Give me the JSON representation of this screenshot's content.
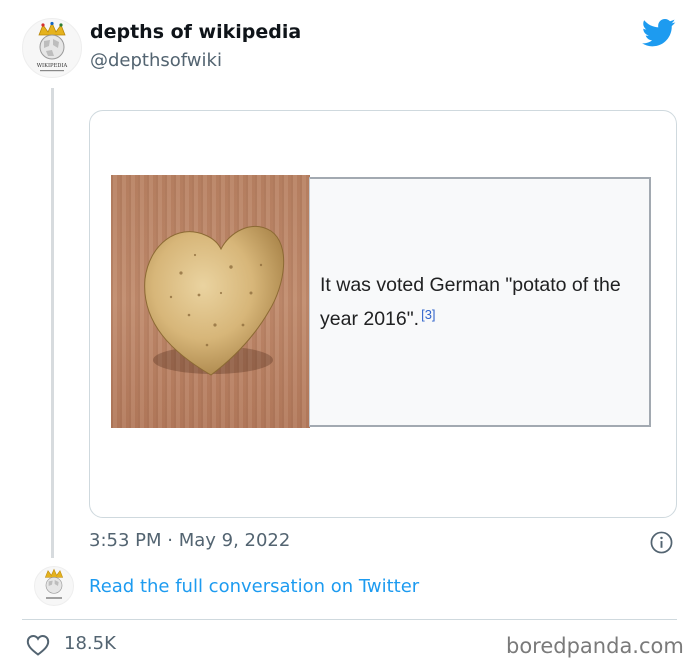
{
  "tweet": {
    "author_name": "depths of wikipedia",
    "author_handle": "@depthsofwiki",
    "avatar_label": "WIKIPEDIA",
    "timestamp": "3:53 PM · May 9, 2022",
    "read_more": "Read the full conversation on Twitter",
    "likes": "18.5K"
  },
  "card": {
    "image_icon": "heart-shaped-potato-image",
    "caption": "It was voted German \"potato of the year 2016\".",
    "citation": "[3]"
  },
  "watermark": "boredpanda.com",
  "colors": {
    "twitter_blue": "#1d9bf0",
    "muted_text": "#536471",
    "wiki_link": "#3366cc"
  }
}
